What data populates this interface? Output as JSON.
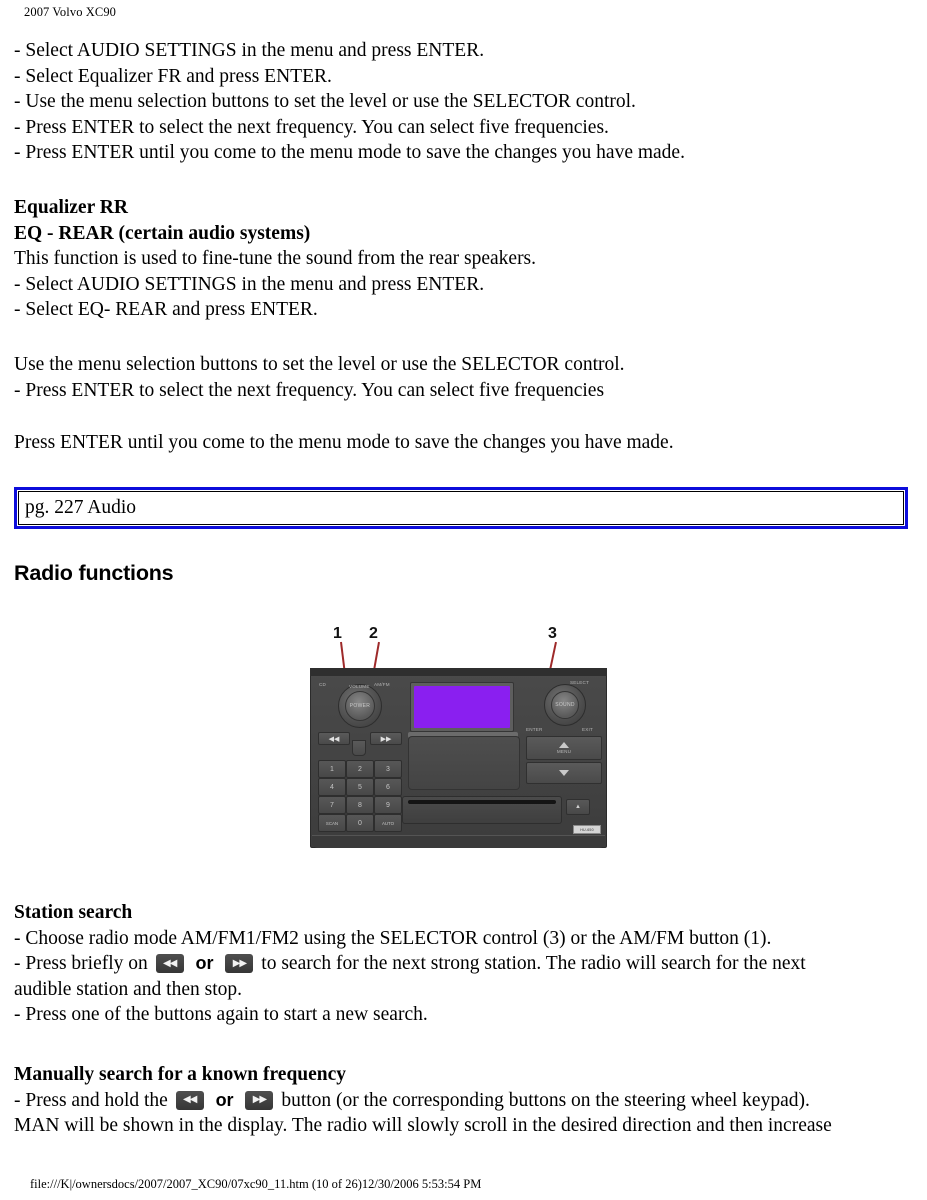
{
  "header": {
    "title": "2007 Volvo XC90"
  },
  "intro_steps": {
    "lines": [
      "- Select AUDIO SETTINGS in the menu and press ENTER.",
      "- Select Equalizer FR and press ENTER.",
      "- Use the menu selection buttons to set the level or use the SELECTOR control.",
      "- Press ENTER to select the next frequency. You can select five frequencies.",
      "- Press ENTER until you come to the menu mode to save the changes you have made."
    ]
  },
  "equalizer_rr": {
    "heading": "Equalizer RR",
    "subheading": "EQ - REAR (certain audio systems)",
    "lines": [
      "This function is used to fine-tune the sound from the rear speakers.",
      "- Select AUDIO SETTINGS in the menu and press ENTER.",
      "- Select EQ- REAR and press ENTER."
    ],
    "lines2": [
      "Use the menu selection buttons to set the level or use the SELECTOR control.",
      "- Press ENTER to select the next frequency. You can select five frequencies"
    ],
    "closing": "Press ENTER until you come to the menu mode to save the changes you have made."
  },
  "page_box": {
    "label": "pg. 227 Audio",
    "border_color": "#0d0ddb"
  },
  "radio_functions": {
    "heading": "Radio functions"
  },
  "figure": {
    "callouts": [
      {
        "number": "1"
      },
      {
        "number": "2"
      },
      {
        "number": "3"
      }
    ],
    "radio": {
      "labels": {
        "cd": "CD",
        "amfm": "AM/FM",
        "power": "POWER",
        "volume": "VOLUME",
        "sound": "SOUND",
        "selector": "SELECT",
        "enter": "ENTER",
        "exit": "EXIT",
        "menu": "MENU",
        "brand": "HU-650"
      },
      "keypad": [
        "1",
        "2",
        "3",
        "4",
        "5",
        "6",
        "7",
        "8",
        "9",
        "SCAN",
        "0",
        "AUTO"
      ],
      "seek_back_glyph": "◀◀",
      "seek_fwd_glyph": "▶▶",
      "eject_glyph": "▲",
      "display_color": "#8a1ff0"
    }
  },
  "station_search": {
    "heading": "Station search",
    "line1": "- Choose radio mode AM/FM1/FM2 using the SELECTOR control (3) or the AM/FM button (1).",
    "line2_a": "- Press briefly on",
    "line2_or": "or",
    "line2_b": "to search for the next strong station. The radio will search for the next",
    "line3": "audible station and then stop.",
    "line4": "- Press one of the buttons again to start a new search."
  },
  "manual_search": {
    "heading": "Manually search for a known frequency",
    "line1_a": "- Press and hold the",
    "line1_or": "or",
    "line1_b": "button (or the corresponding buttons on the steering wheel keypad).",
    "line2": "MAN will be shown in the display. The radio will slowly scroll in the desired direction and then increase"
  },
  "footer": {
    "path": "file:///K|/ownersdocs/2007/2007_XC90/07xc90_11.htm (10 of 26)12/30/2006 5:53:54 PM"
  }
}
